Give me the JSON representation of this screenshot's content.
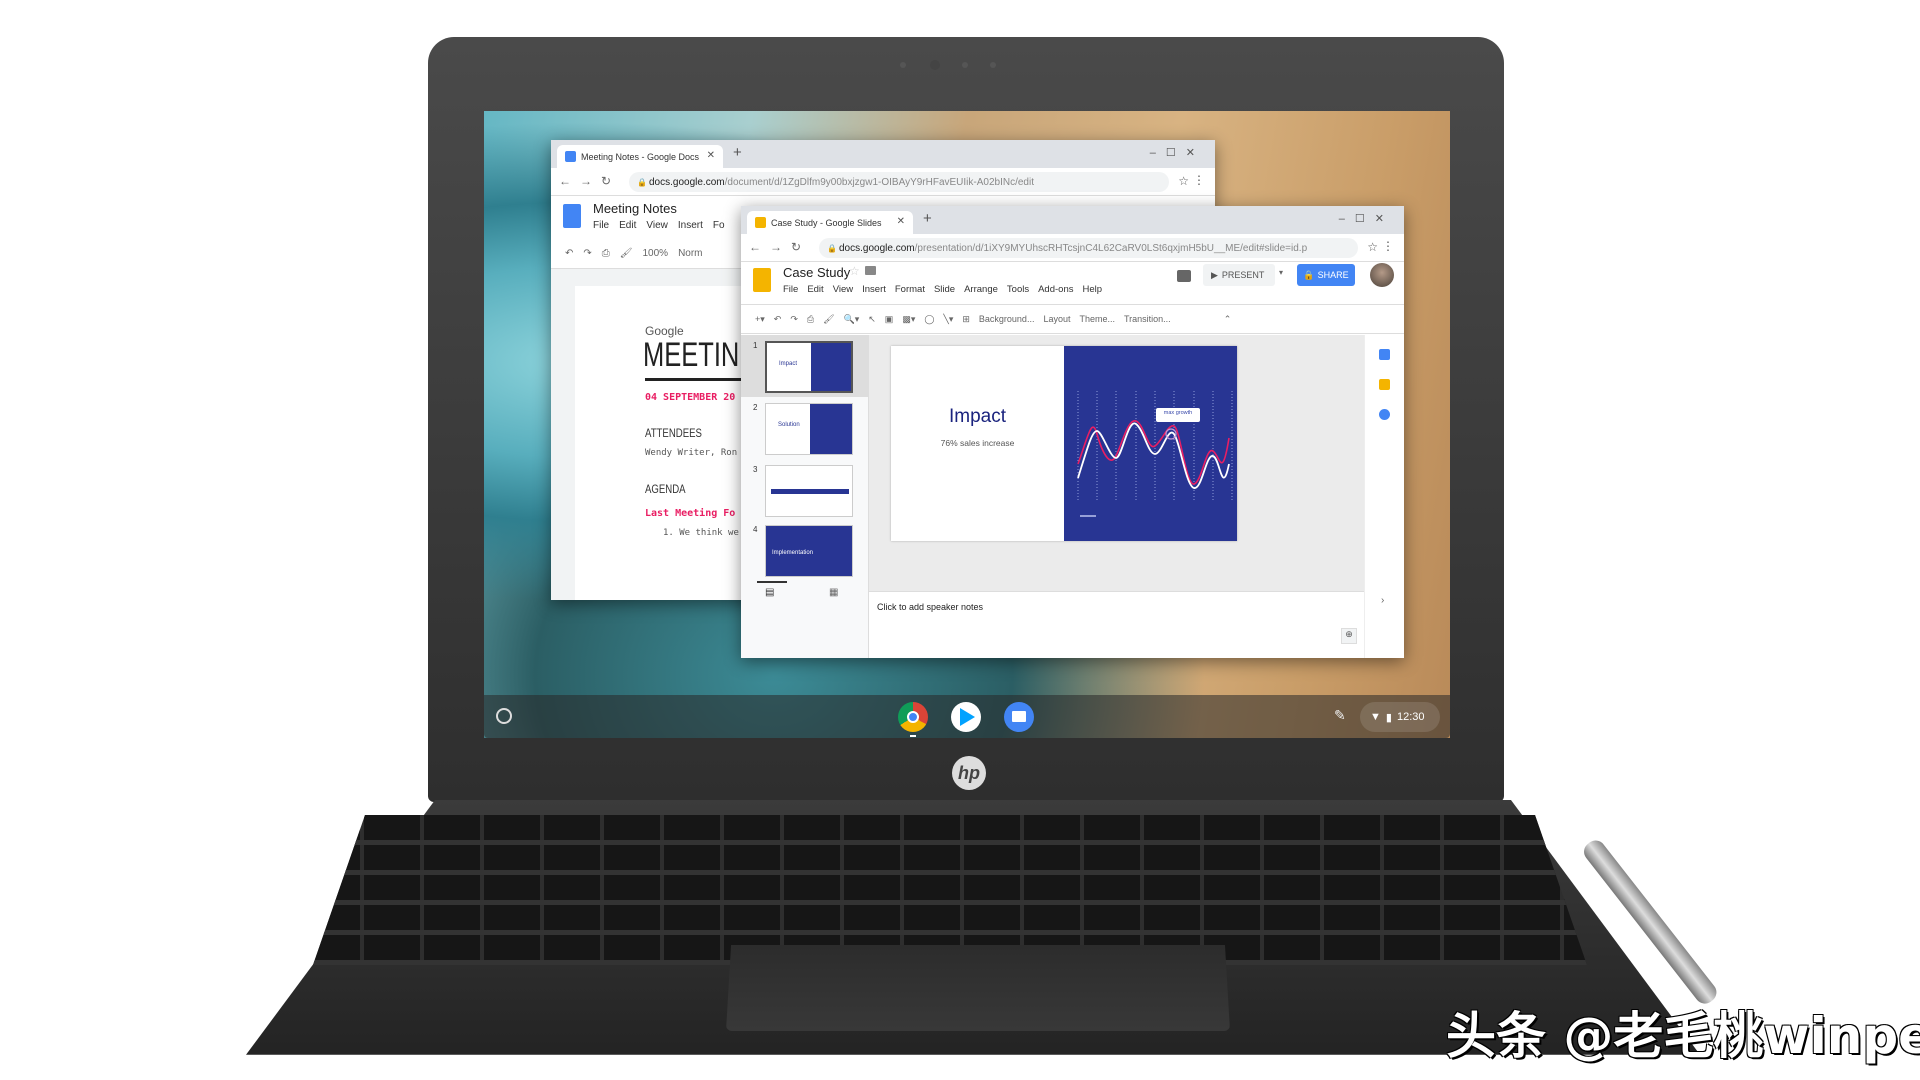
{
  "docs_window": {
    "tab_title": "Meeting Notes - Google Docs",
    "url_host": "docs.google.com",
    "url_path": "/document/d/1ZgDlfm9y00bxjzgw1-OIBAyY9rHFavEUIik-A02bINc/edit",
    "doc_title": "Meeting Notes",
    "menu": [
      "File",
      "Edit",
      "View",
      "Insert",
      "Fo"
    ],
    "zoom": "100%",
    "style": "Norm",
    "content": {
      "brand": "Google",
      "heading": "MEETIN",
      "date": "04 SEPTEMBER 20",
      "attendees_label": "ATTENDEES",
      "attendees": "Wendy Writer, Ron",
      "agenda_label": "AGENDA",
      "agenda_item": "Last Meeting Fo",
      "list_item": "1. We think we"
    }
  },
  "slides_window": {
    "tab_title": "Case Study - Google Slides",
    "url_host": "docs.google.com",
    "url_path": "/presentation/d/1iXY9MYUhscRHTcsjnC4L62CaRV0LSt6qxjmH5bU__ME/edit#slide=id.p",
    "doc_title": "Case Study",
    "menu": [
      "File",
      "Edit",
      "View",
      "Insert",
      "Format",
      "Slide",
      "Arrange",
      "Tools",
      "Add-ons",
      "Help"
    ],
    "present_label": "PRESENT",
    "share_label": "SHARE",
    "toolbar": [
      "Background...",
      "Layout",
      "Theme...",
      "Transition..."
    ],
    "thumbnails": [
      {
        "num": "1",
        "title": "Impact"
      },
      {
        "num": "2",
        "title": "Solution"
      },
      {
        "num": "3",
        "title": ""
      },
      {
        "num": "4",
        "title": "Implementation"
      }
    ],
    "slide": {
      "title": "Impact",
      "subtitle": "76% sales increase",
      "callout": "max growth"
    },
    "speaker_notes_placeholder": "Click to add speaker notes",
    "colors": {
      "slide_blue": "#283593",
      "accent_pink": "#e91e63",
      "share_blue": "#4285f4",
      "slides_yellow": "#f4b400"
    }
  },
  "shelf": {
    "apps": [
      {
        "name": "Chrome"
      },
      {
        "name": "Play Store"
      },
      {
        "name": "Files"
      }
    ],
    "time": "12:30"
  },
  "brand_logo": "hp",
  "watermark": "头条 @老毛桃winpe"
}
